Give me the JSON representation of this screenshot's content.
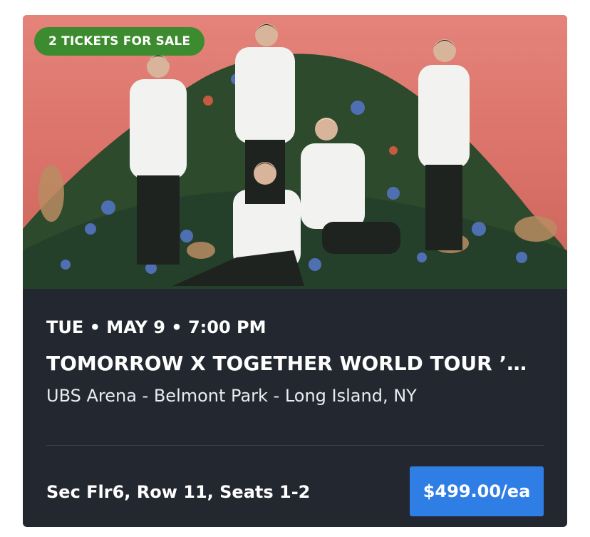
{
  "badge": {
    "label": "2 TICKETS FOR SALE",
    "color": "#3d8b2f"
  },
  "event": {
    "date_time": "TUE • MAY 9 • 7:00 PM",
    "title": "TOMORROW X TOGETHER WORLD TOUR ’…",
    "venue": "UBS Arena - Belmont Park - Long Island, NY"
  },
  "listing": {
    "seats": "Sec Flr6, Row 11, Seats 1-2",
    "price": "$499.00/ea",
    "price_button_color": "#2f7ee6"
  },
  "colors": {
    "card_background": "#232730",
    "hero_background": "#e07a72"
  }
}
